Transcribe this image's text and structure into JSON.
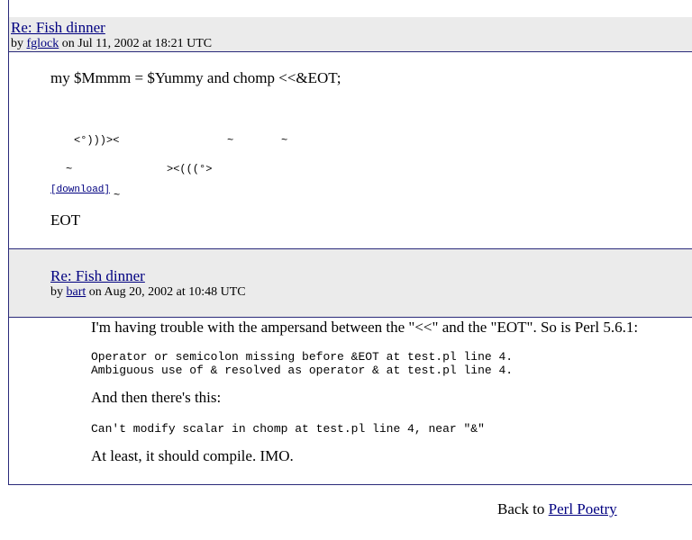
{
  "post": {
    "title": "Re: Fish dinner",
    "by": "by ",
    "author": "fglock",
    "posted": " on Jul 11, 2002 at 18:21 UTC",
    "intro": "my $Mmmm = $Yummy and chomp <<&EOT;",
    "ascii": {
      "fish1": "<°)))><",
      "tilde1": "~",
      "tilde2": "~",
      "tilde3": "~",
      "fish2": "><(((°>",
      "tilde4": "~"
    },
    "download": "[download]",
    "eot": "EOT"
  },
  "reply": {
    "title": "Re: Fish dinner",
    "by": "by ",
    "author": "bart",
    "posted": " on Aug 20, 2002 at 10:48 UTC",
    "p1": "I'm having trouble with the ampersand between the \"<<\" and the \"EOT\". So is Perl 5.6.1:",
    "code1_line1": "Operator or semicolon missing before &EOT at test.pl line 4.",
    "code1_line2": "Ambiguous use of & resolved as operator & at test.pl line 4.",
    "p2": "And then there's this:",
    "code2": "Can't modify scalar in chomp at test.pl line 4, near \"&\"",
    "p3": "At least, it should compile. IMO."
  },
  "footer": {
    "back_prefix": "Back to ",
    "back_link": "Perl Poetry"
  }
}
